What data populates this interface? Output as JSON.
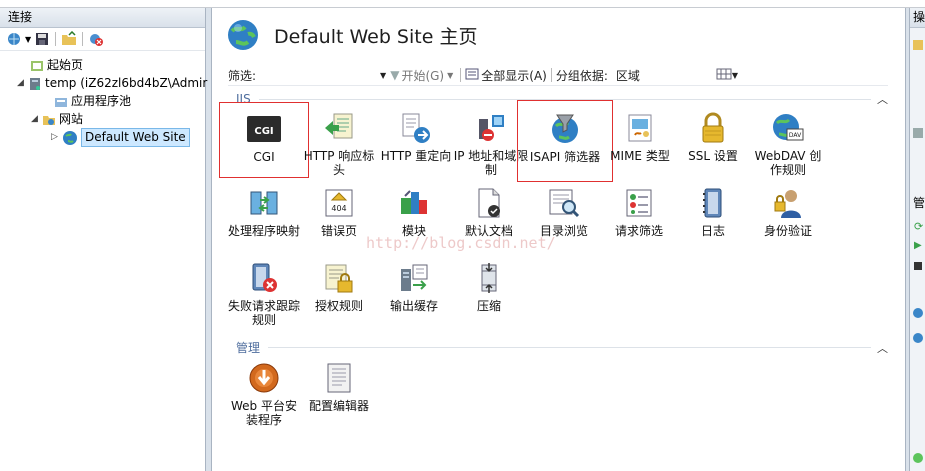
{
  "connections": {
    "title": "连接",
    "tree": [
      {
        "label": "起始页",
        "icon": "start-page-icon"
      },
      {
        "label": "temp (iZ62zl6bd4bZ\\Admir",
        "icon": "server-icon"
      },
      {
        "label": "应用程序池",
        "icon": "app-pool-icon"
      },
      {
        "label": "网站",
        "icon": "sites-folder-icon"
      },
      {
        "label": "Default Web Site",
        "icon": "globe-icon"
      }
    ]
  },
  "header": {
    "title": "Default Web Site 主页"
  },
  "filter": {
    "label": "筛选:",
    "go": "开始(G)",
    "show_all": "全部显示(A)",
    "group_by_label": "分组依据:",
    "group_by_value": "区域"
  },
  "sections": {
    "iis": "IIS",
    "manage": "管理"
  },
  "features": [
    {
      "label": "CGI"
    },
    {
      "label": "HTTP 响应标头"
    },
    {
      "label": "HTTP 重定向"
    },
    {
      "label": "IP 地址和域限制"
    },
    {
      "label": "ISAPI 筛选器"
    },
    {
      "label": "MIME 类型"
    },
    {
      "label": "SSL 设置"
    },
    {
      "label": "WebDAV 创作规则"
    },
    {
      "label": "处理程序映射"
    },
    {
      "label": "错误页"
    },
    {
      "label": "模块"
    },
    {
      "label": "默认文档"
    },
    {
      "label": "目录浏览"
    },
    {
      "label": "请求筛选"
    },
    {
      "label": "日志"
    },
    {
      "label": "身份验证"
    },
    {
      "label": "失败请求跟踪规则"
    },
    {
      "label": "授权规则"
    },
    {
      "label": "输出缓存"
    },
    {
      "label": "压缩"
    }
  ],
  "manage_features": [
    {
      "label": "Web 平台安装程序"
    },
    {
      "label": "配置编辑器"
    }
  ],
  "watermark": "http://blog.csdn.net/",
  "right_panel": {
    "actions_label": "操",
    "manage_label": "管"
  }
}
